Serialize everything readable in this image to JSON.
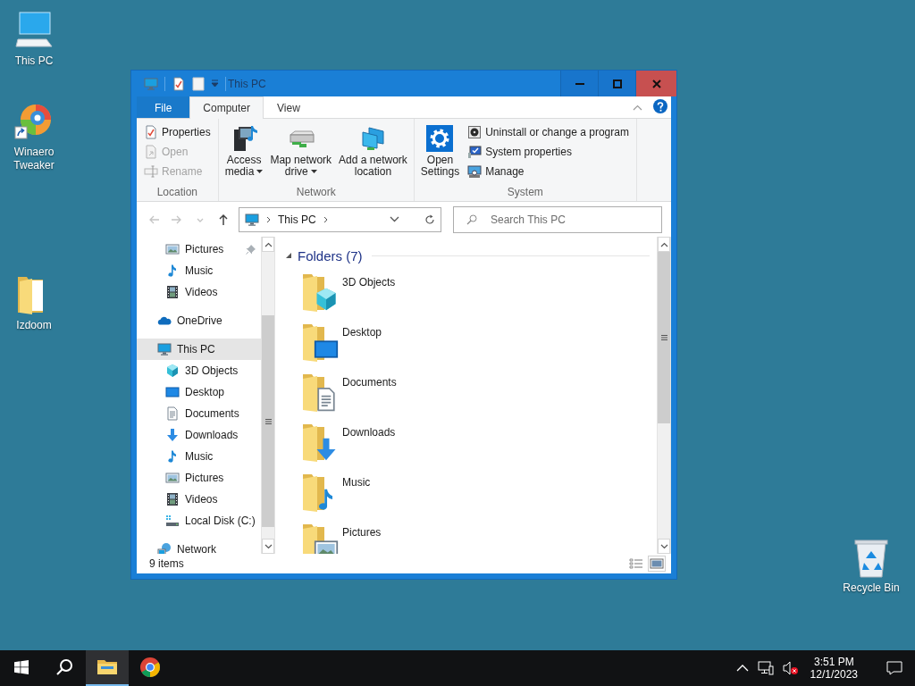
{
  "desktop_icons": [
    {
      "label": "This PC",
      "kind": "pc"
    },
    {
      "label": "Winaero Tweaker",
      "kind": "app_shortcut"
    },
    {
      "label": "Izdoom",
      "kind": "folder"
    },
    {
      "label": "Recycle Bin",
      "kind": "recycle_bin"
    }
  ],
  "window": {
    "title": "This PC",
    "ribbon": {
      "tabs": [
        {
          "label": "File",
          "kind": "file",
          "selected": false
        },
        {
          "label": "Computer",
          "kind": "tab",
          "selected": true
        },
        {
          "label": "View",
          "kind": "tab",
          "selected": false
        }
      ],
      "groups": [
        {
          "label": "Location",
          "items": [
            {
              "label": "Properties",
              "kind": "small",
              "disabled": false
            },
            {
              "label": "Open",
              "kind": "small",
              "disabled": true
            },
            {
              "label": "Rename",
              "kind": "small",
              "disabled": true
            }
          ]
        },
        {
          "label": "Network",
          "items": [
            {
              "label": "Access\nmedia",
              "kind": "large",
              "disabled": false,
              "dropdown": true
            },
            {
              "label": "Map network\ndrive",
              "kind": "large",
              "disabled": false,
              "dropdown": true
            },
            {
              "label": "Add a network\nlocation",
              "kind": "large",
              "disabled": false,
              "dropdown": false
            }
          ]
        },
        {
          "label": "System",
          "items": [
            {
              "label": "Open\nSettings",
              "kind": "large",
              "disabled": false,
              "dropdown": false
            },
            {
              "label": "Uninstall or change a program",
              "kind": "small",
              "disabled": false
            },
            {
              "label": "System properties",
              "kind": "small",
              "disabled": false
            },
            {
              "label": "Manage",
              "kind": "small",
              "disabled": false
            }
          ]
        }
      ]
    },
    "nav_buttons": [
      {
        "kind": "back",
        "disabled": true
      },
      {
        "kind": "forward",
        "disabled": true
      },
      {
        "kind": "recent",
        "disabled": true
      },
      {
        "kind": "up",
        "disabled": false
      }
    ],
    "address_bar": {
      "path": [
        "This PC"
      ]
    },
    "search": {
      "placeholder": "Search This PC"
    },
    "nav_pane": {
      "items": [
        {
          "children": [
            {
              "label": "Pictures",
              "kind": "pictures",
              "pinned": true,
              "selected": false
            },
            {
              "label": "Music",
              "kind": "music",
              "pinned": false,
              "selected": false
            },
            {
              "label": "Videos",
              "kind": "videos",
              "pinned": false,
              "selected": false
            }
          ]
        },
        {
          "label": "OneDrive",
          "kind": "onedrive",
          "selected": false
        },
        {
          "label": "This PC",
          "kind": "pc",
          "selected": true,
          "children": [
            {
              "label": "3D Objects",
              "kind": "cube",
              "selected": false
            },
            {
              "label": "Desktop",
              "kind": "desktop",
              "selected": false
            },
            {
              "label": "Documents",
              "kind": "documents",
              "selected": false
            },
            {
              "label": "Downloads",
              "kind": "downloads",
              "selected": false
            },
            {
              "label": "Music",
              "kind": "music",
              "selected": false
            },
            {
              "label": "Pictures",
              "kind": "pictures",
              "selected": false
            },
            {
              "label": "Videos",
              "kind": "videos",
              "selected": false
            },
            {
              "label": "Local Disk (C:)",
              "kind": "disk",
              "selected": false
            }
          ]
        },
        {
          "label": "Network",
          "kind": "network",
          "selected": false
        }
      ]
    },
    "content": {
      "groups": [
        {
          "label": "Folders (7)",
          "expanded": true,
          "items": [
            {
              "label": "3D Objects",
              "kind": "cube"
            },
            {
              "label": "Desktop",
              "kind": "desktop"
            },
            {
              "label": "Documents",
              "kind": "documents"
            },
            {
              "label": "Downloads",
              "kind": "downloads"
            },
            {
              "label": "Music",
              "kind": "music"
            },
            {
              "label": "Pictures",
              "kind": "pictures"
            }
          ]
        }
      ]
    },
    "status_bar": {
      "item_count": "9 items",
      "views": [
        {
          "kind": "details",
          "selected": false
        },
        {
          "kind": "large_icons",
          "selected": true
        }
      ]
    }
  },
  "taskbar": {
    "apps": [
      {
        "kind": "explorer",
        "active": true
      },
      {
        "kind": "chrome",
        "active": false
      }
    ],
    "volume_muted": true,
    "time": "3:51 PM",
    "date": "12/1/2023"
  }
}
